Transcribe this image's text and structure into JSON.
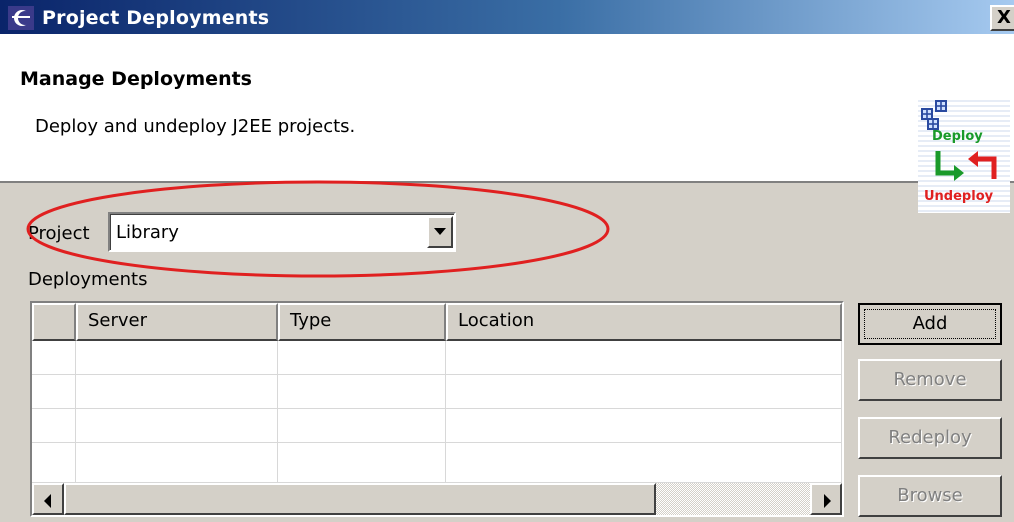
{
  "window": {
    "title": "Project Deployments",
    "close_label": "X"
  },
  "banner": {
    "title": "Manage Deployments",
    "description": "Deploy and undeploy J2EE projects.",
    "graphic_labels": {
      "deploy": "Deploy",
      "undeploy": "Undeploy"
    }
  },
  "project": {
    "label": "Project",
    "selected": "Library"
  },
  "deployments": {
    "label": "Deployments",
    "columns": [
      "",
      "Server",
      "Type",
      "Location"
    ],
    "rows": [
      [
        "",
        "",
        "",
        ""
      ],
      [
        "",
        "",
        "",
        ""
      ],
      [
        "",
        "",
        "",
        ""
      ],
      [
        "",
        "",
        "",
        ""
      ]
    ]
  },
  "buttons": {
    "add": "Add",
    "remove": "Remove",
    "redeploy": "Redeploy",
    "browse": "Browse"
  },
  "colors": {
    "titlebar_start": "#0a246a",
    "titlebar_end": "#a6caf0",
    "dialog_bg": "#d4d0c8",
    "highlight_ellipse": "#e02020",
    "deploy_green": "#1a9a2a",
    "undeploy_red": "#e02020"
  }
}
